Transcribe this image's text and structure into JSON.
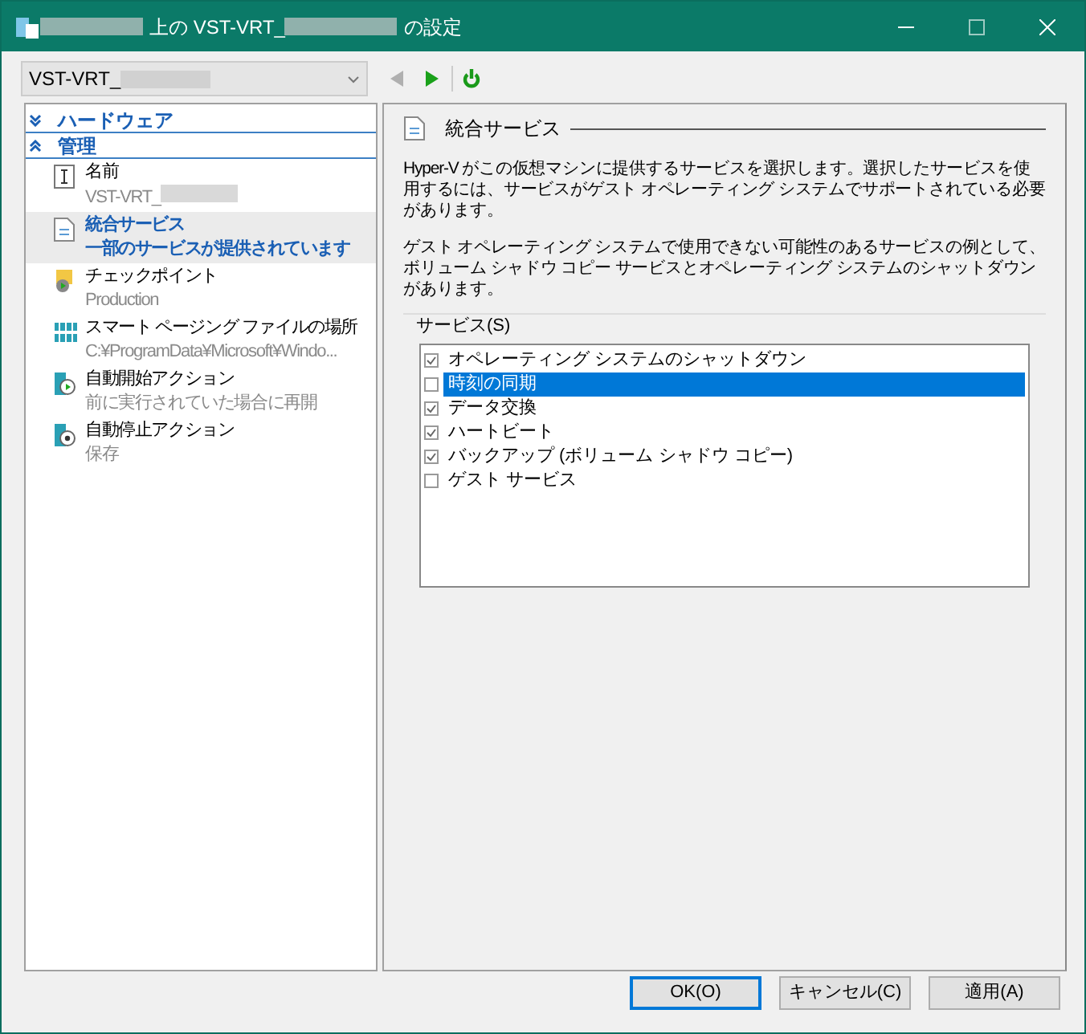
{
  "window": {
    "title_before": "上の VST-VRT_",
    "title_after": "の設定"
  },
  "vm_selector": {
    "value": "VST-VRT_"
  },
  "toolbar": {
    "back_disabled": true,
    "forward_disabled": false
  },
  "sidebar": {
    "sections": [
      {
        "label": "ハードウェア",
        "expanded": false
      },
      {
        "label": "管理",
        "expanded": true,
        "items": [
          {
            "kind": "name",
            "title": "名前",
            "subtitle": "VST-VRT_",
            "selected": false
          },
          {
            "kind": "integration",
            "title": "統合サービス",
            "subtitle": "一部のサービスが提供されています",
            "selected": true
          },
          {
            "kind": "checkpoint",
            "title": "チェックポイント",
            "subtitle": "Production",
            "selected": false
          },
          {
            "kind": "paging",
            "title": "スマート ページング ファイルの場所",
            "subtitle": "C:¥ProgramData¥Microsoft¥Windo...",
            "selected": false
          },
          {
            "kind": "start",
            "title": "自動開始アクション",
            "subtitle": "前に実行されていた場合に再開",
            "selected": false
          },
          {
            "kind": "stop",
            "title": "自動停止アクション",
            "subtitle": "保存",
            "selected": false
          }
        ]
      }
    ]
  },
  "panel": {
    "title": "統合サービス",
    "paragraphs": [
      "Hyper-V がこの仮想マシンに提供するサービスを選択します。選択したサービスを使用するには、サービスがゲスト オペレーティング システムでサポートされている必要があります。",
      "ゲスト オペレーティング システムで使用できない可能性のあるサービスの例として、ボリューム シャドウ コピー サービスとオペレーティング システムのシャットダウンがあります。"
    ],
    "services_label": "サービス(S)",
    "services": [
      {
        "label": "オペレーティング システムのシャットダウン",
        "checked": true,
        "selected": false
      },
      {
        "label": "時刻の同期",
        "checked": false,
        "selected": true
      },
      {
        "label": "データ交換",
        "checked": true,
        "selected": false
      },
      {
        "label": "ハートビート",
        "checked": true,
        "selected": false
      },
      {
        "label": "バックアップ (ボリューム シャドウ コピー)",
        "checked": true,
        "selected": false
      },
      {
        "label": "ゲスト サービス",
        "checked": false,
        "selected": false
      }
    ]
  },
  "buttons": [
    {
      "label": "OK(O)",
      "default": true
    },
    {
      "label": "キャンセル(C)",
      "default": false
    },
    {
      "label": "適用(A)",
      "default": false
    }
  ]
}
